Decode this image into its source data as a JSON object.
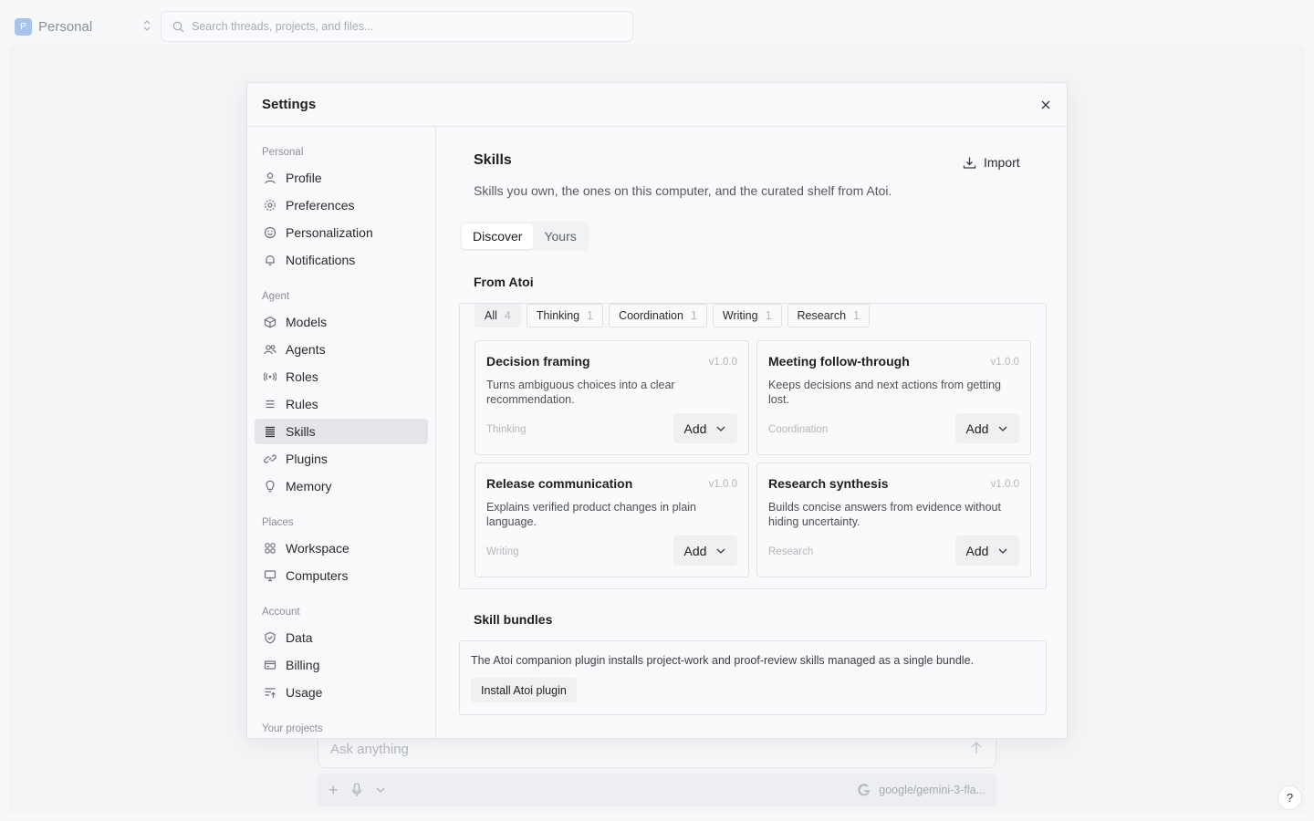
{
  "topbar": {
    "workspace_initial": "P",
    "workspace_name": "Personal",
    "search_placeholder": "Search threads, projects, and files..."
  },
  "composer": {
    "placeholder": "Ask anything",
    "model": "google/gemini-3-fla..."
  },
  "help_label": "?",
  "modal": {
    "title": "Settings",
    "sidebar": {
      "sections": [
        {
          "label": "Personal",
          "items": [
            "Profile",
            "Preferences",
            "Personalization",
            "Notifications"
          ]
        },
        {
          "label": "Agent",
          "items": [
            "Models",
            "Agents",
            "Roles",
            "Rules",
            "Skills",
            "Plugins",
            "Memory"
          ]
        },
        {
          "label": "Places",
          "items": [
            "Workspace",
            "Computers"
          ]
        },
        {
          "label": "Account",
          "items": [
            "Data",
            "Billing",
            "Usage"
          ]
        },
        {
          "label": "Your projects",
          "items": []
        }
      ],
      "active_item": "Skills"
    },
    "content": {
      "title": "Skills",
      "import_label": "Import",
      "description": "Skills you own, the ones on this computer, and the curated shelf from Atoi.",
      "tabs": [
        "Discover",
        "Yours"
      ],
      "active_tab": "Discover",
      "from_title": "From Atoi",
      "filters": [
        {
          "label": "All",
          "count": "4"
        },
        {
          "label": "Thinking",
          "count": "1"
        },
        {
          "label": "Coordination",
          "count": "1"
        },
        {
          "label": "Writing",
          "count": "1"
        },
        {
          "label": "Research",
          "count": "1"
        }
      ],
      "skills": [
        {
          "title": "Decision framing",
          "version": "v1.0.0",
          "description": "Turns ambiguous choices into a clear recommendation.",
          "category": "Thinking",
          "action": "Add"
        },
        {
          "title": "Meeting follow-through",
          "version": "v1.0.0",
          "description": "Keeps decisions and next actions from getting lost.",
          "category": "Coordination",
          "action": "Add"
        },
        {
          "title": "Release communication",
          "version": "v1.0.0",
          "description": "Explains verified product changes in plain language.",
          "category": "Writing",
          "action": "Add"
        },
        {
          "title": "Research synthesis",
          "version": "v1.0.0",
          "description": "Builds concise answers from evidence without hiding uncertainty.",
          "category": "Research",
          "action": "Add"
        }
      ],
      "bundles_title": "Skill bundles",
      "bundle_description": "The Atoi companion plugin installs project-work and proof-review skills managed as a single bundle.",
      "install_label": "Install Atoi plugin"
    }
  }
}
